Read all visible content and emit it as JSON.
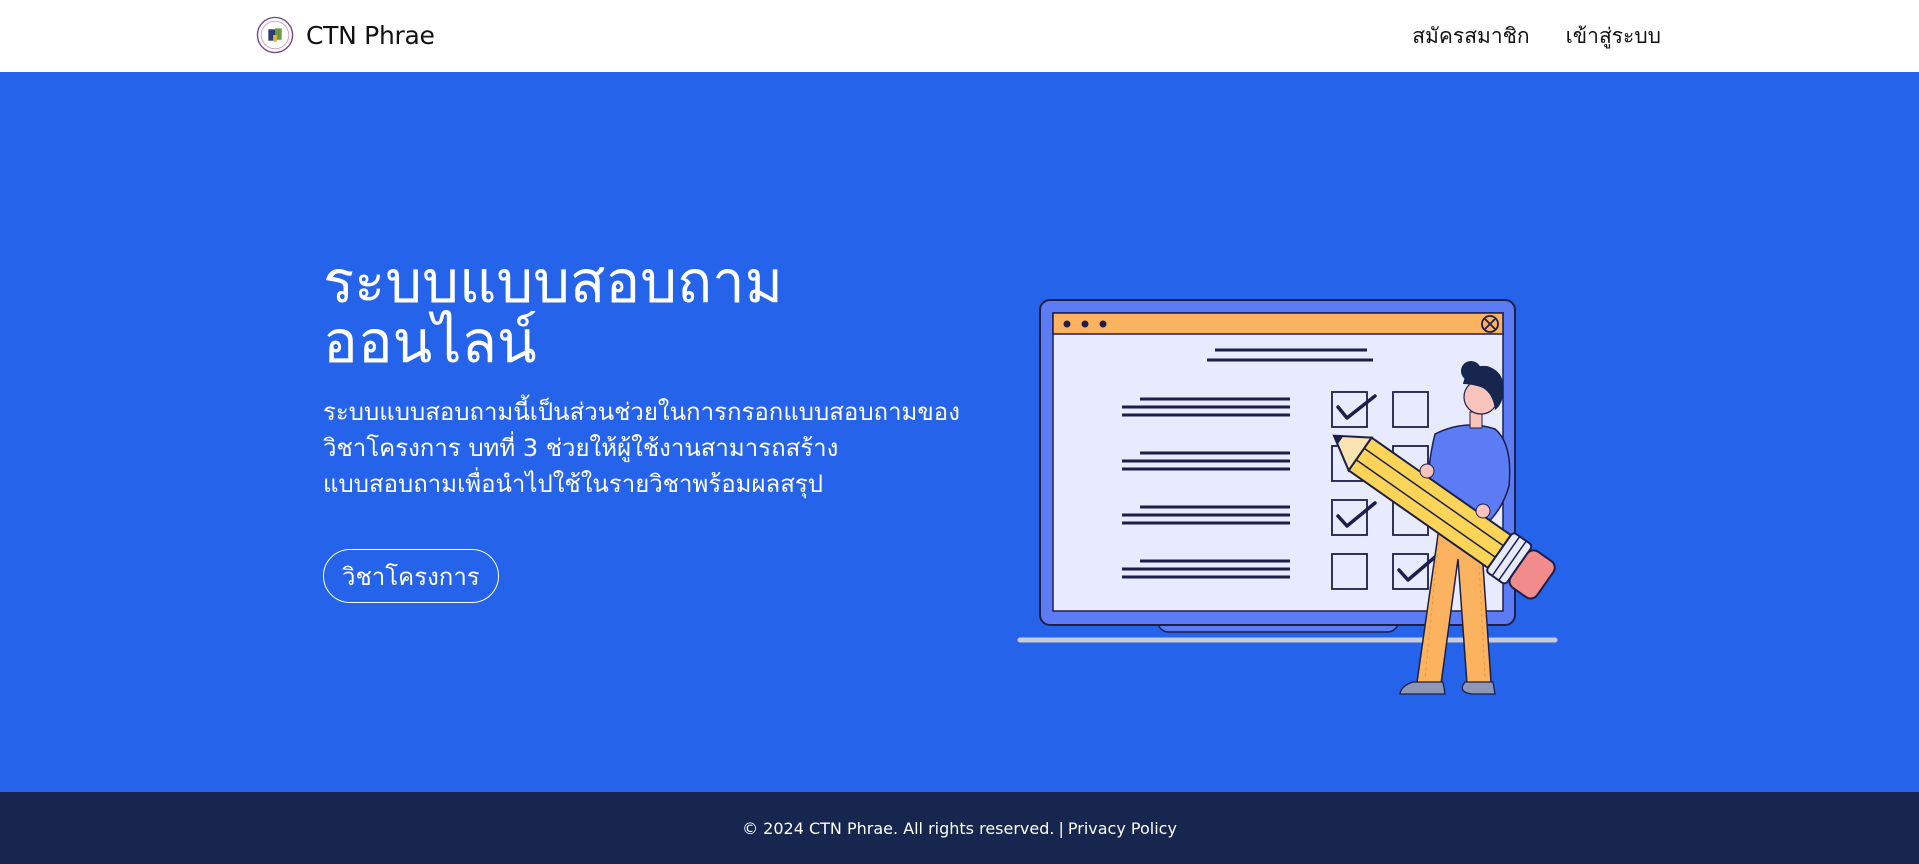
{
  "header": {
    "brand_name": "CTN Phrae",
    "logo_icon": "school-emblem-icon",
    "nav": [
      {
        "label": "สมัครสมาชิก"
      },
      {
        "label": "เข้าสู่ระบบ"
      }
    ]
  },
  "hero": {
    "title": "ระบบแบบสอบถามออนไลน์",
    "description": "ระบบแบบสอบถามนี้เป็นส่วนช่วยในการกรอกแบบสอบถามของ วิชาโครงการ บทที่ 3 ช่วยให้ผู้ใช้งานสามารถสร้างแบบสอบถามเพื่อนำไปใช้ในรายวิชาพร้อมผลสรุป",
    "button_label": "วิชาโครงการ",
    "illustration": "survey-checklist-illustration"
  },
  "footer": {
    "copyright": "© 2024 CTN Phrae. All rights reserved.",
    "separator": "|",
    "privacy_label": "Privacy Policy"
  },
  "colors": {
    "hero_bg": "#2563eb",
    "footer_bg": "#16264f",
    "header_bg": "#ffffff",
    "window_bar": "#fbb35f",
    "screen_bg": "#e8eafd"
  }
}
